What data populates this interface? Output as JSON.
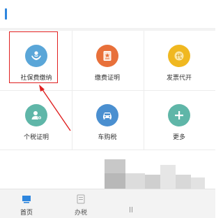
{
  "colors": {
    "accent": "#2e86de",
    "social_security": "#5aa6d8",
    "payment_proof": "#e8703a",
    "invoice": "#f0b820",
    "tax_proof": "#5fb6a8",
    "vehicle_tax": "#4a8fd0",
    "more": "#5fb6a8",
    "highlight": "#e02020"
  },
  "services": {
    "social_security": {
      "label": "社保费缴纳",
      "icon": "hands-holding-person-icon"
    },
    "payment_proof": {
      "label": "缴费证明",
      "icon": "certificate-icon"
    },
    "invoice": {
      "label": "发票代开",
      "icon": "invoice-badge-icon",
      "icon_text": "代"
    },
    "tax_proof": {
      "label": "个税证明",
      "icon": "user-certificate-icon"
    },
    "vehicle_tax": {
      "label": "车购税",
      "icon": "car-icon"
    },
    "more": {
      "label": "更多",
      "icon": "plus-icon"
    }
  },
  "tabbar": {
    "home": {
      "label": "首页",
      "icon": "home-icon"
    },
    "tax_office": {
      "label": "办税",
      "icon": "document-icon"
    },
    "third": {
      "label": "",
      "icon": "menu-icon",
      "icon_text": "||"
    }
  }
}
